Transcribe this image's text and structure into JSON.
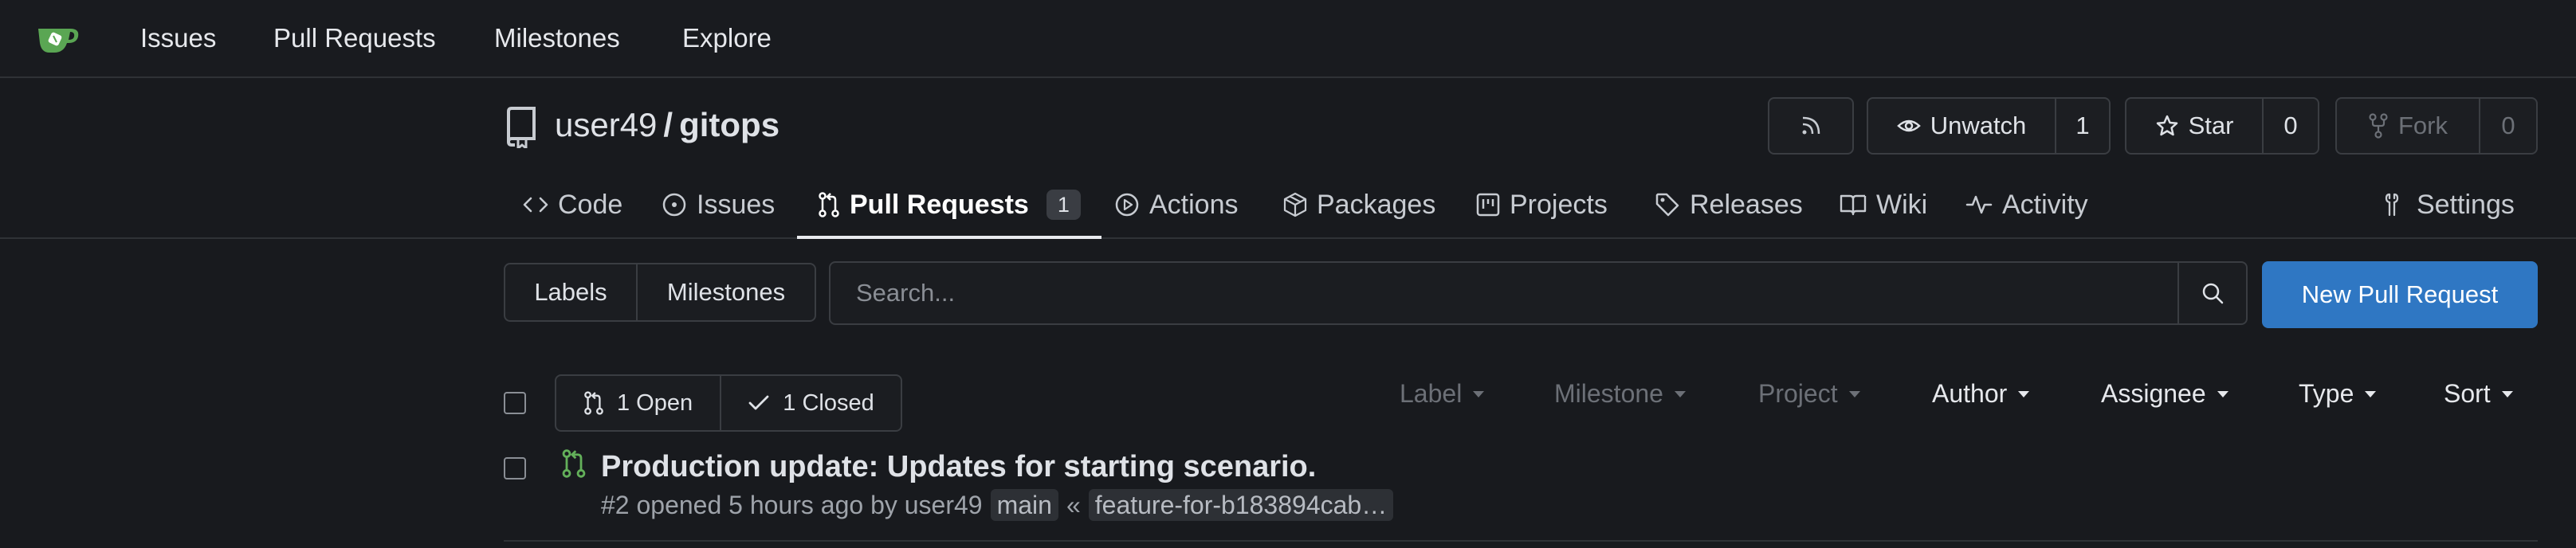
{
  "nav": {
    "items": [
      "Issues",
      "Pull Requests",
      "Milestones",
      "Explore"
    ]
  },
  "repo": {
    "owner": "user49",
    "separator": "/",
    "name": "gitops",
    "unwatch_label": "Unwatch",
    "watch_count": "1",
    "star_label": "Star",
    "star_count": "0",
    "fork_label": "Fork",
    "fork_count": "0"
  },
  "tabs": {
    "code": "Code",
    "issues": "Issues",
    "pull_requests": "Pull Requests",
    "pull_requests_count": "1",
    "actions": "Actions",
    "packages": "Packages",
    "projects": "Projects",
    "releases": "Releases",
    "wiki": "Wiki",
    "activity": "Activity",
    "settings": "Settings"
  },
  "filters": {
    "labels": "Labels",
    "milestones": "Milestones",
    "search_placeholder": "Search...",
    "new_pr": "New Pull Request"
  },
  "list_header": {
    "open": "1 Open",
    "closed": "1 Closed",
    "label": "Label",
    "milestone": "Milestone",
    "project": "Project",
    "author": "Author",
    "assignee": "Assignee",
    "type": "Type",
    "sort": "Sort"
  },
  "pull_requests": [
    {
      "title": "Production update: Updates for starting scenario.",
      "meta": "#2 opened 5 hours ago by user49",
      "target_branch": "main",
      "arrow": "«",
      "source_branch": "feature-for-b183894cab…"
    }
  ],
  "colors": {
    "background": "#181a1e",
    "primary_button": "#2f77c3",
    "open_pr_icon": "#63b05a",
    "logo": "#5aa653"
  }
}
